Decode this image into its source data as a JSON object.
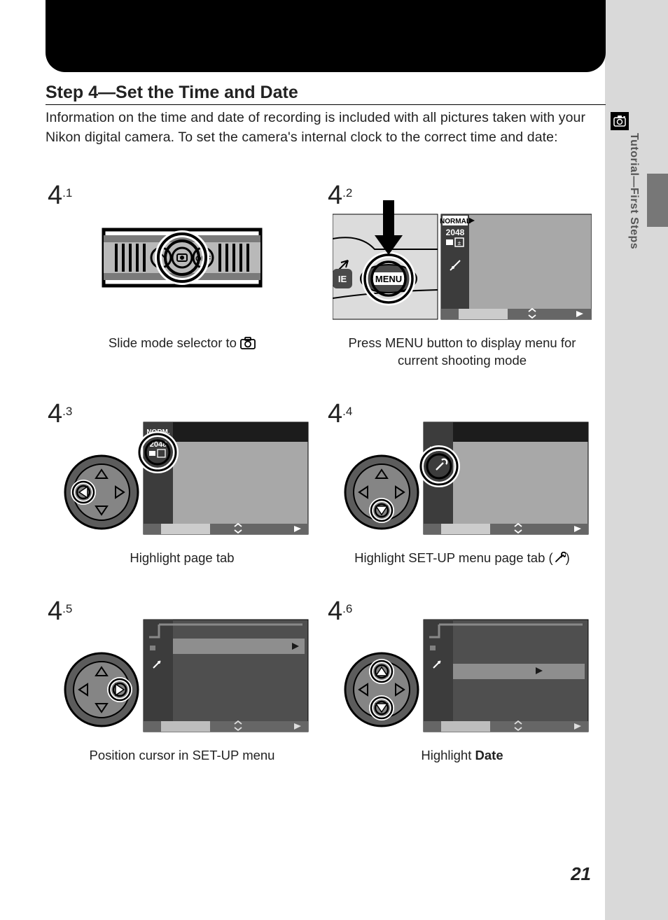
{
  "step_title": "Step 4—Set the Time and Date",
  "intro": "Information on the time and date of recording is included with all pictures taken with your Nikon digital camera.  To set the camera's internal clock to the correct time and date:",
  "side_tab": "Tutorial—First Steps",
  "page_number": "21",
  "steps": [
    {
      "num_big": "4",
      "num_dec": ".1",
      "caption_pre": "Slide mode selector to ",
      "caption_icon": "camera-icon",
      "caption_post": ""
    },
    {
      "num_big": "4",
      "num_dec": ".2",
      "caption_pre": "Press MENU button to display menu for current shooting mode",
      "caption_icon": "",
      "caption_post": ""
    },
    {
      "num_big": "4",
      "num_dec": ".3",
      "caption_pre": "Highlight page tab",
      "caption_icon": "",
      "caption_post": ""
    },
    {
      "num_big": "4",
      "num_dec": ".4",
      "caption_pre": "Highlight SET-UP menu page tab (",
      "caption_icon": "wrench-icon",
      "caption_post": ")"
    },
    {
      "num_big": "4",
      "num_dec": ".5",
      "caption_pre": "Position cursor in SET-UP menu",
      "caption_icon": "",
      "caption_post": ""
    },
    {
      "num_big": "4",
      "num_dec": ".6",
      "caption_pre": "Highlight ",
      "caption_icon": "",
      "caption_post": "",
      "bold": "Date"
    }
  ],
  "lcd": {
    "normal": "NORMAL",
    "size": "2048",
    "menu": "MENU",
    "ie": "IE",
    "norm_short": "NORM."
  }
}
